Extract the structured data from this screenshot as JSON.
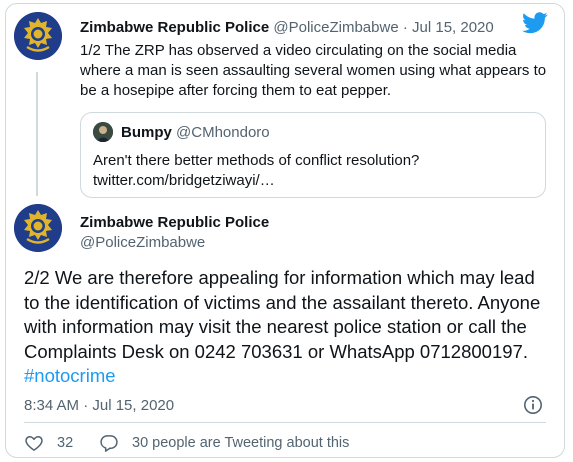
{
  "tweet1": {
    "author_name": "Zimbabwe Republic Police",
    "author_handle": "@PoliceZimbabwe",
    "separator": "·",
    "date": "Jul 15, 2020",
    "text": "1/2 The ZRP has observed a video circulating on the social media where a man is seen assaulting several women using what appears to be a hosepipe after forcing them to eat pepper."
  },
  "quote": {
    "author_name": "Bumpy",
    "author_handle": "@CMhondoro",
    "line1": "Aren't there better methods of conflict resolution?",
    "line2": "twitter.com/bridgetziwayi/…"
  },
  "tweet2": {
    "author_name": "Zimbabwe Republic Police",
    "author_handle": "@PoliceZimbabwe",
    "text": "2/2 We are therefore appealing for information which may lead to the identification of victims and the assailant thereto. Anyone with information may visit the nearest police station or call the Complaints Desk on 0242 703631 or WhatsApp 0712800197. ",
    "hashtag": "#notocrime",
    "timestamp": "8:34 AM · Jul 15, 2020"
  },
  "actions": {
    "likes": "32",
    "reply_label": "30 people are Tweeting about this"
  },
  "icons": {
    "brand": "twitter-bird-icon",
    "info": "info-icon",
    "like": "heart-icon",
    "reply": "speech-bubble-icon"
  },
  "colors": {
    "twitter_blue": "#1d9bf0",
    "muted_text": "#536471",
    "border": "#cfd9de",
    "text": "#0f1419"
  }
}
